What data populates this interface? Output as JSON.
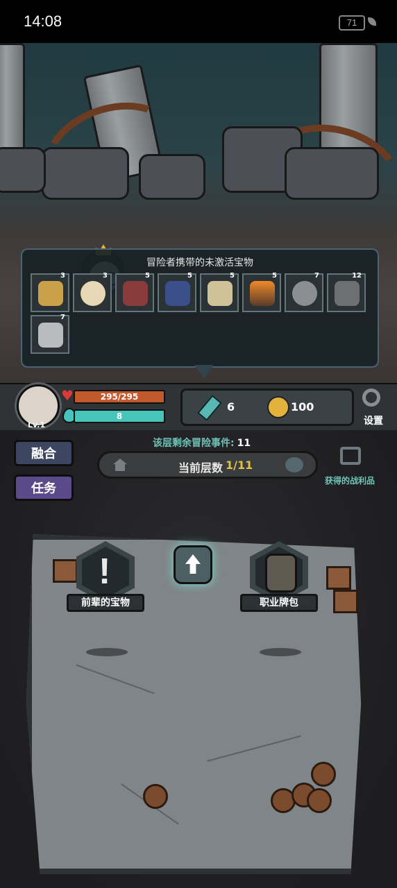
{
  "status_bar": {
    "time": "14:08",
    "battery": "71"
  },
  "treasure_panel": {
    "title": "冒险者携带的未激活宝物",
    "items": [
      {
        "icon": "gold-coin-emblem-icon",
        "count": "3"
      },
      {
        "icon": "horn-icon",
        "count": "3"
      },
      {
        "icon": "red-crystal-icon",
        "count": "5"
      },
      {
        "icon": "blue-shield-icon",
        "count": "5"
      },
      {
        "icon": "scroll-map-icon",
        "count": "5"
      },
      {
        "icon": "fire-torch-icon",
        "count": "5"
      },
      {
        "icon": "stone-pouch-icon",
        "count": "7"
      },
      {
        "icon": "gray-mask-icon",
        "count": "12"
      },
      {
        "icon": "silver-coin-icon",
        "count": "7"
      }
    ]
  },
  "hud": {
    "level": "Lv.1",
    "hp": "295/295",
    "mp": "8",
    "crystals": "6",
    "gold": "100",
    "settings_label": "设置"
  },
  "floor": {
    "remaining_label": "该层剩余冒险事件:",
    "remaining_value": "11",
    "current_label": "当前层数",
    "current_value": "1/11",
    "loot_label": "获得的战利品"
  },
  "side_buttons": {
    "merge": "融合",
    "quest": "任务"
  },
  "nodes": {
    "treasure": "前辈的宝物",
    "class_bag": "职业牌包"
  },
  "colors": {
    "hp": "#c2592d",
    "mp": "#47c5ba",
    "accent_teal": "#6fc3b8",
    "floor_value": "#e0c34b"
  }
}
